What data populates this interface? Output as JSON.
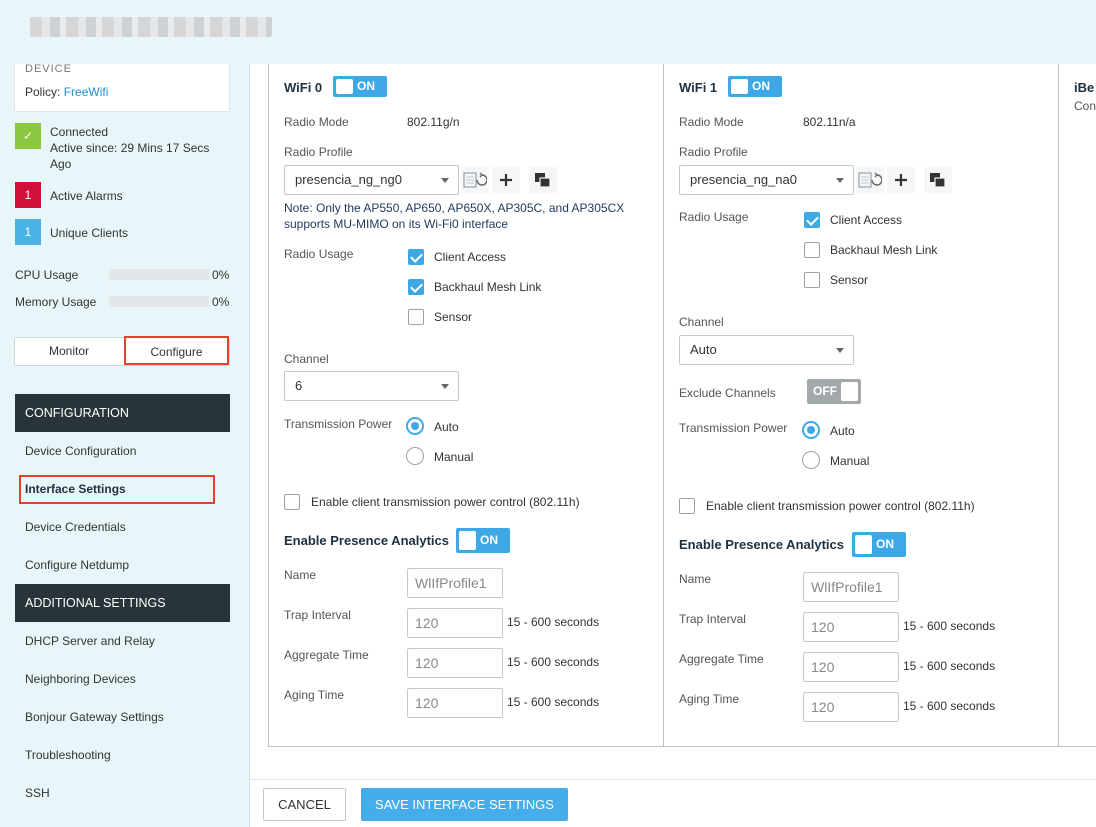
{
  "header": {
    "blurred_title": ""
  },
  "sidebar": {
    "device_name": "DEVICE",
    "policy_label": "Policy:",
    "policy_value": "FreeWifi",
    "status": {
      "check": "✓",
      "line1": "Connected",
      "line2": "Active since: 29 Mins 17 Secs",
      "line3": "Ago"
    },
    "alarms": {
      "count": "1",
      "label": "Active Alarms"
    },
    "clients": {
      "count": "1",
      "label": "Unique Clients"
    },
    "cpu": {
      "label": "CPU Usage",
      "value": "0%",
      "fraction": 0
    },
    "memory": {
      "label": "Memory Usage",
      "value": "0%",
      "fraction": 0
    },
    "tabs": {
      "monitor": "Monitor",
      "configure": "Configure"
    },
    "configuration_header": "CONFIGURATION",
    "config_items": [
      "Device Configuration",
      "Interface Settings",
      "Device Credentials",
      "Configure Netdump"
    ],
    "additional_header": "ADDITIONAL SETTINGS",
    "additional_items": [
      "DHCP Server and Relay",
      "Neighboring Devices",
      "Bonjour Gateway Settings",
      "Troubleshooting",
      "SSH"
    ]
  },
  "wifi0": {
    "title": "WiFi 0",
    "toggle": "ON",
    "radio_mode_label": "Radio Mode",
    "radio_mode_value": "802.11g/n",
    "radio_profile_label": "Radio Profile",
    "radio_profile_value": "presencia_ng_ng0",
    "note": "Note: Only the AP550, AP650, AP650X, AP305C, and AP305CX supports MU-MIMO on its Wi-Fi0 interface",
    "radio_usage_label": "Radio Usage",
    "usage": [
      {
        "label": "Client Access",
        "checked": true
      },
      {
        "label": "Backhaul Mesh Link",
        "checked": true
      },
      {
        "label": "Sensor",
        "checked": false
      }
    ],
    "channel_label": "Channel",
    "channel_value": "6",
    "tx_power_label": "Transmission Power",
    "tx_auto": "Auto",
    "tx_manual": "Manual",
    "tx_selected": "Auto",
    "client_tx_label": "Enable client transmission power control (802.11h)",
    "presence_label": "Enable Presence Analytics",
    "presence_toggle": "ON",
    "name_label": "Name",
    "name_value": "WlIfProfile1",
    "trap_label": "Trap Interval",
    "trap_value": "120",
    "aggregate_label": "Aggregate Time",
    "aggregate_value": "120",
    "aging_label": "Aging Time",
    "aging_value": "120",
    "range_unit": "15 - 600 seconds"
  },
  "wifi1": {
    "title": "WiFi 1",
    "toggle": "ON",
    "radio_mode_label": "Radio Mode",
    "radio_mode_value": "802.11n/a",
    "radio_profile_label": "Radio Profile",
    "radio_profile_value": "presencia_ng_na0",
    "radio_usage_label": "Radio Usage",
    "usage": [
      {
        "label": "Client Access",
        "checked": true
      },
      {
        "label": "Backhaul Mesh Link",
        "checked": false
      },
      {
        "label": "Sensor",
        "checked": false
      }
    ],
    "channel_label": "Channel",
    "channel_value": "Auto",
    "exclude_label": "Exclude Channels",
    "exclude_toggle": "OFF",
    "tx_power_label": "Transmission Power",
    "tx_auto": "Auto",
    "tx_manual": "Manual",
    "tx_selected": "Auto",
    "client_tx_label": "Enable client transmission power control (802.11h)",
    "presence_label": "Enable Presence Analytics",
    "presence_toggle": "ON",
    "name_label": "Name",
    "name_value": "WlIfProfile1",
    "trap_label": "Trap Interval",
    "trap_value": "120",
    "aggregate_label": "Aggregate Time",
    "aggregate_value": "120",
    "aging_label": "Aging Time",
    "aging_value": "120",
    "range_unit": "15 - 600 seconds"
  },
  "ibeacon": {
    "title": "iBe",
    "sub": "Con"
  },
  "footer": {
    "cancel": "CANCEL",
    "save": "SAVE INTERFACE SETTINGS"
  },
  "colors": {
    "accent": "#3ea8e6",
    "highlight": "#e3412f",
    "header_dark": "#28343a",
    "connected": "#8dc63f",
    "alarm": "#d0103a"
  }
}
